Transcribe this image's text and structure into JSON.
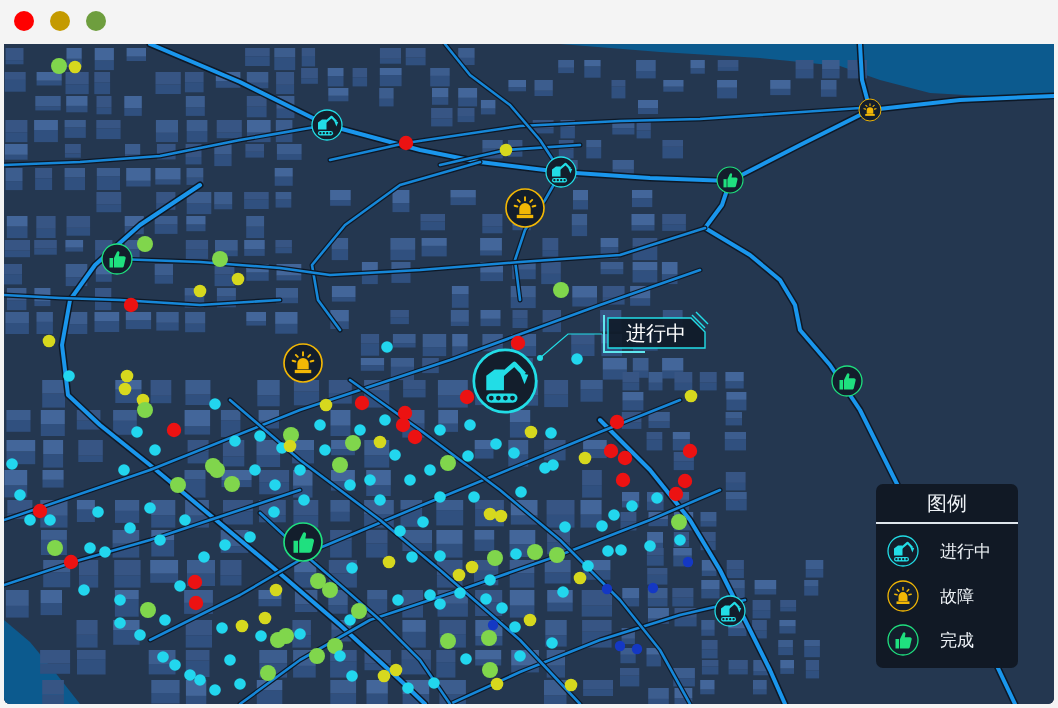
{
  "window": {
    "controls": [
      {
        "color": "#ff0000"
      },
      {
        "color": "#c49a00"
      },
      {
        "color": "#6e9e3e"
      }
    ]
  },
  "map": {
    "markers": [
      {
        "kind": "in_progress",
        "selected": false
      },
      {
        "kind": "fault",
        "selected": false
      },
      {
        "kind": "in_progress",
        "selected": false
      },
      {
        "kind": "done",
        "selected": false
      },
      {
        "kind": "fault",
        "selected": false
      },
      {
        "kind": "done",
        "selected": false
      },
      {
        "kind": "fault",
        "selected": false
      },
      {
        "kind": "in_progress",
        "selected": true,
        "callout": "进行中"
      },
      {
        "kind": "done",
        "selected": false
      },
      {
        "kind": "done",
        "selected": false
      },
      {
        "kind": "in_progress",
        "selected": false
      }
    ],
    "points": [
      {
        "color": "#80d64c"
      },
      {
        "color": "#d6d81e"
      },
      {
        "color": "#ec1212"
      },
      {
        "color": "#d6d81e"
      },
      {
        "color": "#80d64c"
      },
      {
        "color": "#80d64c"
      },
      {
        "color": "#d6d81e"
      },
      {
        "color": "#d6d81e"
      },
      {
        "color": "#ec1212"
      },
      {
        "color": "#d6d81e"
      },
      {
        "color": "#80d64c"
      },
      {
        "color": "#ec1212"
      },
      {
        "color": "#22d6ee"
      },
      {
        "color": "#22d6ee"
      },
      {
        "color": "#22d6ee"
      },
      {
        "color": "#d6d81e"
      },
      {
        "color": "#d6d81e"
      },
      {
        "color": "#d6d81e"
      },
      {
        "color": "#80d64c"
      },
      {
        "color": "#ec1212"
      },
      {
        "color": "#d6d81e"
      },
      {
        "color": "#22d6ee"
      },
      {
        "color": "#ec1212"
      },
      {
        "color": "#ec1212"
      },
      {
        "color": "#ec1212"
      },
      {
        "color": "#ec1212"
      },
      {
        "color": "#ec1212"
      },
      {
        "color": "#d6d81e"
      },
      {
        "color": "#22d6ee"
      },
      {
        "color": "#ec1212"
      },
      {
        "color": "#ec1212"
      },
      {
        "color": "#ec1212"
      },
      {
        "color": "#ec1212"
      },
      {
        "color": "#d6d81e"
      },
      {
        "color": "#ec1212"
      },
      {
        "color": "#ec1212"
      },
      {
        "color": "#ec1212"
      },
      {
        "color": "#22d6ee"
      },
      {
        "color": "#d6d81e"
      },
      {
        "color": "#22d6ee"
      },
      {
        "color": "#80d64c"
      },
      {
        "color": "#22d6ee"
      },
      {
        "color": "#22d6ee"
      },
      {
        "color": "#22d6ee"
      },
      {
        "color": "#80d64c"
      },
      {
        "color": "#d6d81e"
      },
      {
        "color": "#80d64c"
      },
      {
        "color": "#d6d81e"
      },
      {
        "color": "#80d64c"
      },
      {
        "color": "#80d64c"
      },
      {
        "color": "#80d64c"
      },
      {
        "color": "#80d64c"
      },
      {
        "color": "#22d6ee"
      },
      {
        "color": "#22d6ee"
      },
      {
        "color": "#22d6ee"
      },
      {
        "color": "#22d6ee"
      },
      {
        "color": "#ec1212"
      },
      {
        "color": "#80d64c"
      },
      {
        "color": "#ec1212"
      },
      {
        "color": "#22d6ee"
      },
      {
        "color": "#22d6ee"
      },
      {
        "color": "#22d6ee"
      },
      {
        "color": "#22d6ee"
      },
      {
        "color": "#22d6ee"
      },
      {
        "color": "#22d6ee"
      },
      {
        "color": "#22d6ee"
      },
      {
        "color": "#ec1212"
      },
      {
        "color": "#ec1212"
      },
      {
        "color": "#22d6ee"
      },
      {
        "color": "#80d64c"
      },
      {
        "color": "#22d6ee"
      },
      {
        "color": "#22d6ee"
      },
      {
        "color": "#22d6ee"
      },
      {
        "color": "#22d6ee"
      },
      {
        "color": "#22d6ee"
      },
      {
        "color": "#22d6ee"
      },
      {
        "color": "#22d6ee"
      },
      {
        "color": "#22d6ee"
      },
      {
        "color": "#22d6ee"
      },
      {
        "color": "#80d64c"
      },
      {
        "color": "#22d6ee"
      },
      {
        "color": "#22d6ee"
      },
      {
        "color": "#22d6ee"
      },
      {
        "color": "#22d6ee"
      },
      {
        "color": "#22d6ee"
      },
      {
        "color": "#22d6ee"
      },
      {
        "color": "#22d6ee"
      },
      {
        "color": "#22d6ee"
      },
      {
        "color": "#22d6ee"
      },
      {
        "color": "#22d6ee"
      },
      {
        "color": "#80d64c"
      },
      {
        "color": "#22d6ee"
      },
      {
        "color": "#22d6ee"
      },
      {
        "color": "#d6d81e"
      },
      {
        "color": "#d6d81e"
      },
      {
        "color": "#22d6ee"
      },
      {
        "color": "#22d6ee"
      },
      {
        "color": "#22d6ee"
      },
      {
        "color": "#d6d81e"
      },
      {
        "color": "#22d6ee"
      },
      {
        "color": "#22d6ee"
      },
      {
        "color": "#d6d81e"
      },
      {
        "color": "#d6d81e"
      },
      {
        "color": "#22d6ee"
      },
      {
        "color": "#80d64c"
      },
      {
        "color": "#22d6ee"
      },
      {
        "color": "#80d64c"
      },
      {
        "color": "#80d64c"
      },
      {
        "color": "#d6d81e"
      },
      {
        "color": "#22d6ee"
      },
      {
        "color": "#22d6ee"
      },
      {
        "color": "#22d6ee"
      },
      {
        "color": "#22d6ee"
      },
      {
        "color": "#22d6ee"
      },
      {
        "color": "#1438c4"
      },
      {
        "color": "#1438c4"
      },
      {
        "color": "#1438c4"
      },
      {
        "color": "#1438c4"
      },
      {
        "color": "#1438c4"
      },
      {
        "color": "#22d6ee"
      },
      {
        "color": "#1438c4"
      },
      {
        "color": "#80d64c"
      },
      {
        "color": "#80d64c"
      },
      {
        "color": "#22d6ee"
      },
      {
        "color": "#80d64c"
      },
      {
        "color": "#d6d81e"
      },
      {
        "color": "#22d6ee"
      },
      {
        "color": "#22d6ee"
      },
      {
        "color": "#22d6ee"
      },
      {
        "color": "#22d6ee"
      },
      {
        "color": "#22d6ee"
      },
      {
        "color": "#d6d81e"
      },
      {
        "color": "#22d6ee"
      },
      {
        "color": "#22d6ee"
      },
      {
        "color": "#22d6ee"
      },
      {
        "color": "#80d64c"
      },
      {
        "color": "#80d64c"
      },
      {
        "color": "#80d64c"
      },
      {
        "color": "#80d64c"
      },
      {
        "color": "#80d64c"
      },
      {
        "color": "#22d6ee"
      },
      {
        "color": "#d6d81e"
      },
      {
        "color": "#d6d81e"
      },
      {
        "color": "#d6d81e"
      },
      {
        "color": "#22d6ee"
      },
      {
        "color": "#80d64c"
      },
      {
        "color": "#80d64c"
      },
      {
        "color": "#22d6ee"
      },
      {
        "color": "#22d6ee"
      },
      {
        "color": "#80d64c"
      },
      {
        "color": "#22d6ee"
      },
      {
        "color": "#22d6ee"
      },
      {
        "color": "#22d6ee"
      },
      {
        "color": "#22d6ee"
      },
      {
        "color": "#22d6ee"
      },
      {
        "color": "#22d6ee"
      },
      {
        "color": "#d6d81e"
      },
      {
        "color": "#d6d81e"
      },
      {
        "color": "#22d6ee"
      },
      {
        "color": "#d6d81e"
      },
      {
        "color": "#22d6ee"
      },
      {
        "color": "#22d6ee"
      },
      {
        "color": "#22d6ee"
      },
      {
        "color": "#22d6ee"
      },
      {
        "color": "#22d6ee"
      },
      {
        "color": "#22d6ee"
      },
      {
        "color": "#22d6ee"
      },
      {
        "color": "#22d6ee"
      },
      {
        "color": "#22d6ee"
      },
      {
        "color": "#22d6ee"
      },
      {
        "color": "#22d6ee"
      },
      {
        "color": "#22d6ee"
      },
      {
        "color": "#22d6ee"
      },
      {
        "color": "#22d6ee"
      },
      {
        "color": "#22d6ee"
      },
      {
        "color": "#22d6ee"
      },
      {
        "color": "#22d6ee"
      },
      {
        "color": "#22d6ee"
      },
      {
        "color": "#22d6ee"
      },
      {
        "color": "#22d6ee"
      },
      {
        "color": "#22d6ee"
      },
      {
        "color": "#22d6ee"
      },
      {
        "color": "#22d6ee"
      }
    ],
    "legend": {
      "title": "图例",
      "items": [
        {
          "kind": "in_progress",
          "label": "进行中"
        },
        {
          "kind": "fault",
          "label": "故障"
        },
        {
          "kind": "done",
          "label": "完成"
        }
      ]
    }
  }
}
